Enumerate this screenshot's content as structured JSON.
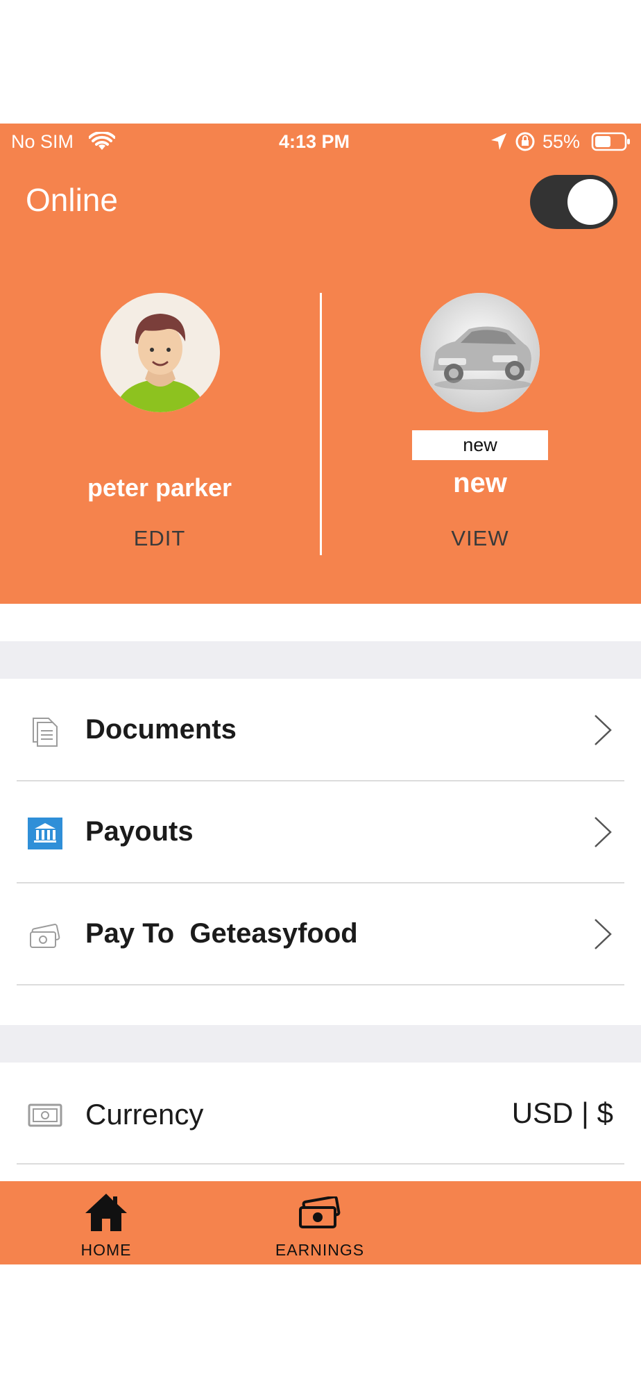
{
  "status_bar": {
    "carrier": "No SIM",
    "time": "4:13 PM",
    "battery": "55%"
  },
  "header": {
    "status_label": "Online",
    "toggle_on": true
  },
  "profile": {
    "name": "peter parker",
    "action": "EDIT"
  },
  "vehicle": {
    "tag": "new",
    "name": "new",
    "action": "VIEW"
  },
  "menu": {
    "items": [
      {
        "label": "Documents",
        "icon": "document-icon"
      },
      {
        "label": "Payouts",
        "icon": "bank-icon"
      },
      {
        "label": "Pay To  Geteasyfood",
        "icon": "cash-icon"
      }
    ]
  },
  "settings": {
    "currency_label": "Currency",
    "currency_value": "USD | $"
  },
  "bottom_nav": {
    "items": [
      {
        "label": "HOME",
        "icon": "home-icon"
      },
      {
        "label": "EARNINGS",
        "icon": "money-icon"
      }
    ]
  },
  "colors": {
    "accent": "#f5834d",
    "band": "#eeeef2"
  }
}
